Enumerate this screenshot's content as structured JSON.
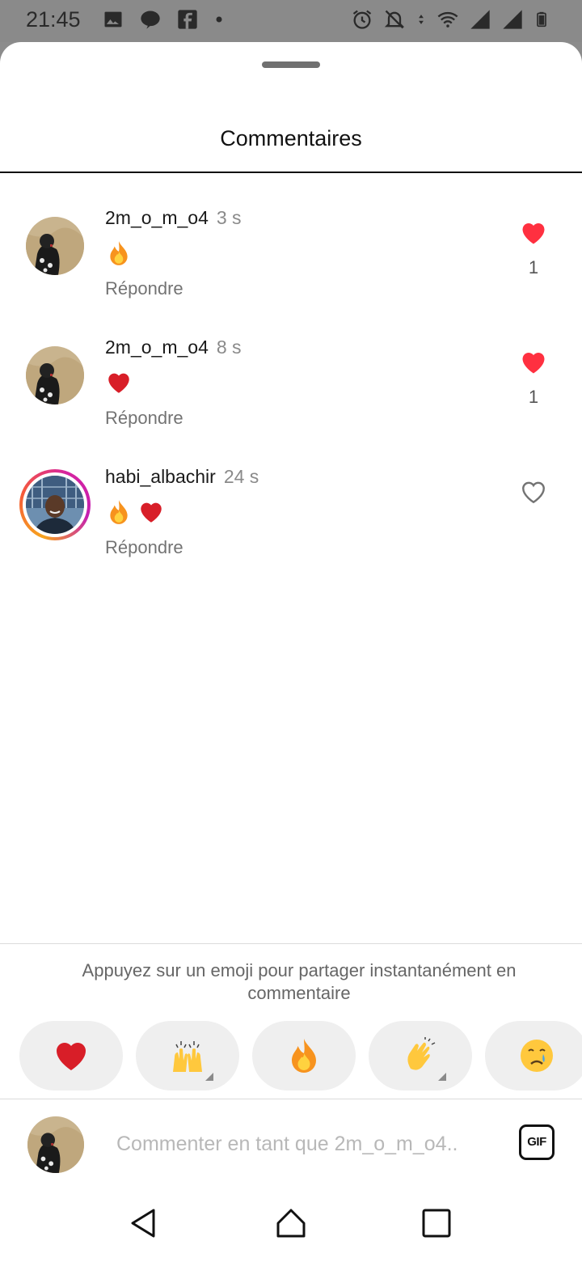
{
  "status_bar": {
    "time": "21:45",
    "left_icons": [
      "image-icon",
      "chat-bubble-icon",
      "facebook-icon",
      "dot-icon"
    ],
    "right_icons": [
      "alarm-icon",
      "bell-off-icon",
      "data-arrows-icon",
      "wifi-icon",
      "signal-icon",
      "signal-icon",
      "battery-icon"
    ]
  },
  "sheet": {
    "title": "Commentaires"
  },
  "comments": [
    {
      "username": "2m_o_m_o4",
      "time": "3 s",
      "emojis": [
        "fire"
      ],
      "reply_label": "Répondre",
      "liked": true,
      "like_count": "1"
    },
    {
      "username": "2m_o_m_o4",
      "time": "8 s",
      "emojis": [
        "heart"
      ],
      "reply_label": "Répondre",
      "liked": true,
      "like_count": "1"
    },
    {
      "username": "habi_albachir",
      "time": "24 s",
      "emojis": [
        "fire",
        "heart"
      ],
      "reply_label": "Répondre",
      "liked": false,
      "like_count": ""
    }
  ],
  "emoji_bar": {
    "hint": "Appuyez sur un emoji pour partager instantanément en commentaire",
    "emojis": [
      "heart",
      "raised-hands",
      "fire",
      "clapping-hands",
      "crying-face"
    ]
  },
  "input": {
    "placeholder": "Commenter en tant que 2m_o_m_o4..",
    "gif_label": "GIF"
  },
  "colors": {
    "like_red": "#ff3040",
    "ring_gradient": [
      "#f7a41d",
      "#d6249f"
    ]
  },
  "navbar": [
    "back-icon",
    "home-icon",
    "recents-icon"
  ]
}
